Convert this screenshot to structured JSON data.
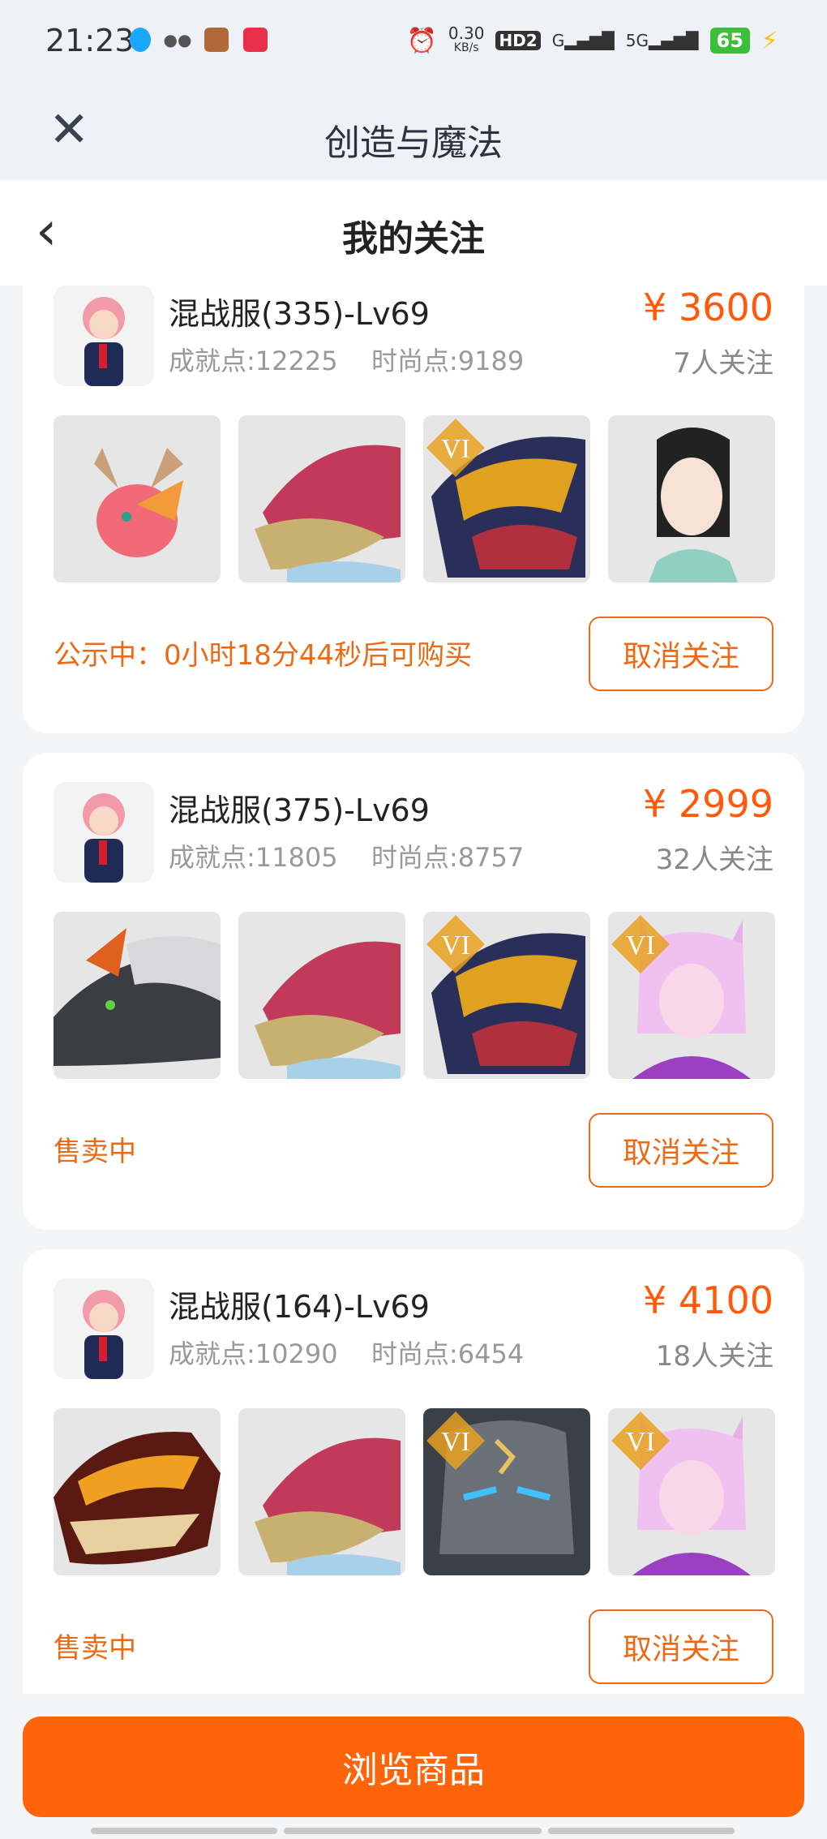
{
  "status_bar": {
    "time": "21:23",
    "net_speed_top": "0.30",
    "net_speed_unit": "KB/s",
    "hd": "HD2",
    "sig1": "G",
    "sig2": "5G",
    "battery": "65",
    "icons": [
      "qq-icon",
      "wechat-icon",
      "game-icon",
      "app-icon",
      "alarm-icon",
      "charging-icon"
    ]
  },
  "app_header": {
    "title": "创造与魔法",
    "close_icon": "close-icon"
  },
  "page_header": {
    "title": "我的关注",
    "back_icon": "back-chevron-icon"
  },
  "cards": [
    {
      "server": "混战服(335)-Lv69",
      "achievement": "成就点:12225",
      "fashion": "时尚点:9189",
      "price": "¥ 3600",
      "watchers": "7人关注",
      "status": "公示中：0小时18分44秒后可购买",
      "button": "取消关注",
      "thumbs": [
        "pink-deer-dragon",
        "pink-gold-dragon",
        "dark-gold-dragon-vi",
        "lady-character"
      ]
    },
    {
      "server": "混战服(375)-Lv69",
      "achievement": "成就点:11805",
      "fashion": "时尚点:8757",
      "price": "¥ 2999",
      "watchers": "32人关注",
      "status": "售卖中",
      "button": "取消关注",
      "thumbs": [
        "black-white-dragon",
        "pink-gold-dragon",
        "dark-gold-dragon-vi",
        "pink-fox-lady-vi"
      ]
    },
    {
      "server": "混战服(164)-Lv69",
      "achievement": "成就点:10290",
      "fashion": "时尚点:6454",
      "price": "¥ 4100",
      "watchers": "18人关注",
      "status": "售卖中",
      "button": "取消关注",
      "thumbs": [
        "fire-dragon",
        "pink-gold-dragon",
        "stone-golem-vi",
        "pink-fox-lady-vi"
      ]
    }
  ],
  "bottom": {
    "browse": "浏览商品"
  },
  "badge_text": "VI",
  "colors": {
    "accent": "#ff640a",
    "accent_text": "#ea6a16",
    "header_bg": "#eef2f6"
  }
}
